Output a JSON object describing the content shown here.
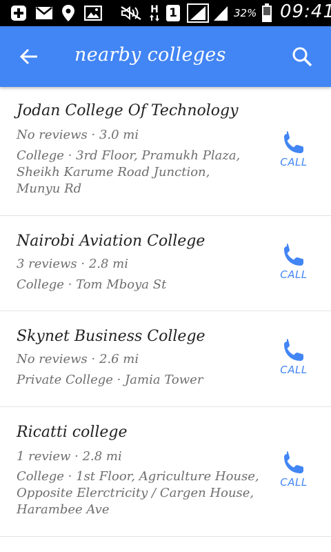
{
  "status_bar": {
    "battery": "32%",
    "time": "09:41",
    "sim_badge": "1",
    "network_letter": "H",
    "icons": [
      "plus-icon",
      "mail-icon",
      "location-icon",
      "image-icon",
      "mute-icon",
      "h-network-icon",
      "sim-badge",
      "signal-icon",
      "signal-icon-2",
      "battery-icon"
    ]
  },
  "app_bar": {
    "title": "nearby colleges",
    "back_icon": "arrow-back-icon",
    "search_icon": "search-icon",
    "color": "#4285f4"
  },
  "results": [
    {
      "name": "Jodan College Of Technology",
      "meta": "No reviews · 3.0 mi",
      "address_lines": [
        "College · 3rd Floor, Pramukh Plaza,",
        "Sheikh Karume Road Junction,",
        "Munyu Rd"
      ],
      "call_label": "CALL"
    },
    {
      "name": "Nairobi Aviation College",
      "meta": "3 reviews · 2.8 mi",
      "address_lines": [
        "College · Tom Mboya St"
      ],
      "call_label": "CALL"
    },
    {
      "name": "Skynet Business College",
      "meta": "No reviews · 2.6 mi",
      "address_lines": [
        "Private College · Jamia Tower"
      ],
      "call_label": "CALL"
    },
    {
      "name": "Ricatti college",
      "meta": "1 review · 2.8 mi",
      "address_lines": [
        "College · 1st Floor, Agriculture House,",
        "Opposite Elerctricity / Cargen House,",
        "Harambee Ave"
      ],
      "call_label": "CALL"
    }
  ],
  "colors": {
    "accent": "#4285f4",
    "status_bar": "#000000",
    "title_text": "#222222",
    "secondary_text": "#6e6e6e"
  }
}
